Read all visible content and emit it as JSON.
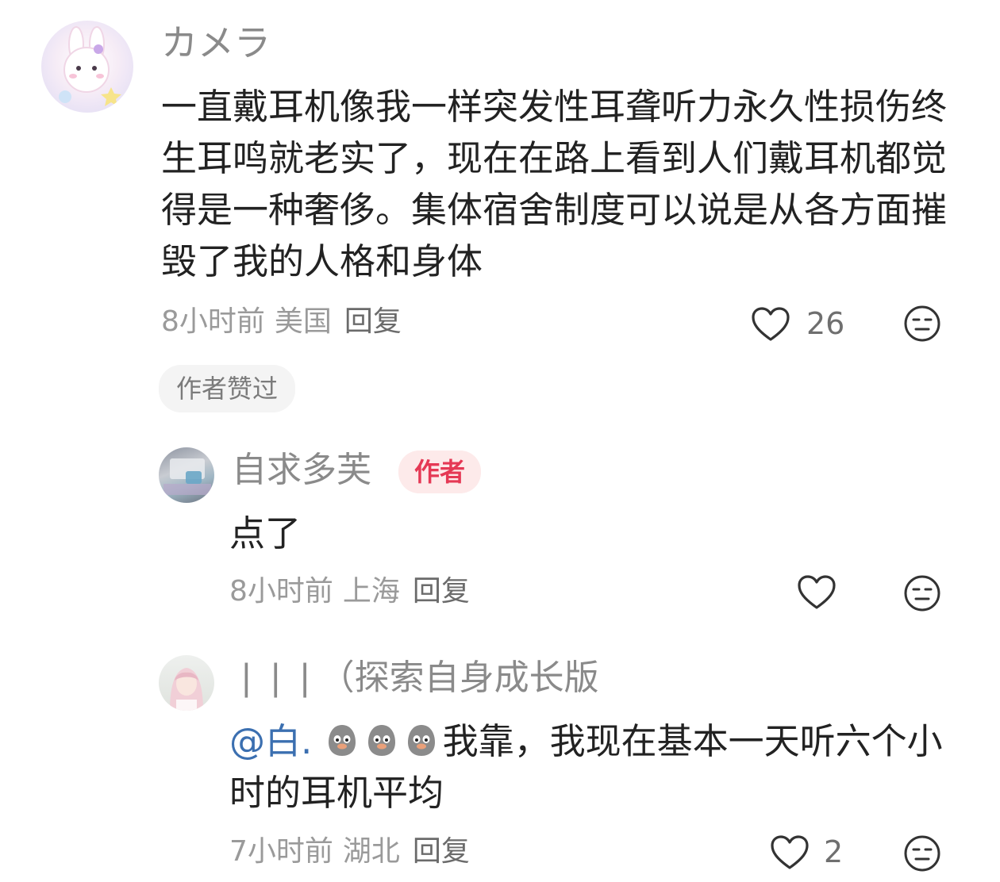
{
  "comments": [
    {
      "username": "カメラ",
      "text": "一直戴耳机像我一样突发性耳聋听力永久性损伤终生耳鸣就老实了，现在在路上看到人们戴耳机都觉得是一种奢侈。集体宿舍制度可以说是从各方面摧毁了我的人格和身体",
      "time": "8小时前",
      "location": "美国",
      "reply_label": "回复",
      "like_count": "26",
      "like_icon": "heart-outline-icon",
      "dislike_icon": "meh-face-icon",
      "liked_by_author_label": "作者赞过"
    },
    {
      "username": "自求多芙",
      "author_badge": "作者",
      "text": "点了",
      "time": "8小时前",
      "location": "上海",
      "reply_label": "回复",
      "like_count": "",
      "like_icon": "heart-outline-icon",
      "dislike_icon": "meh-face-icon"
    },
    {
      "username": "❘❘❘（探索自身成长版",
      "mention": "@白.",
      "emoji_icons": [
        "pigeon-emoji-icon",
        "pigeon-emoji-icon",
        "pigeon-emoji-icon"
      ],
      "text": "我靠，我现在基本一天听六个小时的耳机平均",
      "time": "7小时前",
      "location": "湖北",
      "reply_label": "回复",
      "like_count": "2",
      "like_icon": "heart-outline-icon",
      "dislike_icon": "meh-face-icon"
    }
  ],
  "colors": {
    "author_badge_bg": "#fdeaea",
    "author_badge_text": "#e53955",
    "mention": "#3b6fb0",
    "username": "#8a8a8a",
    "body_text": "#222222"
  }
}
